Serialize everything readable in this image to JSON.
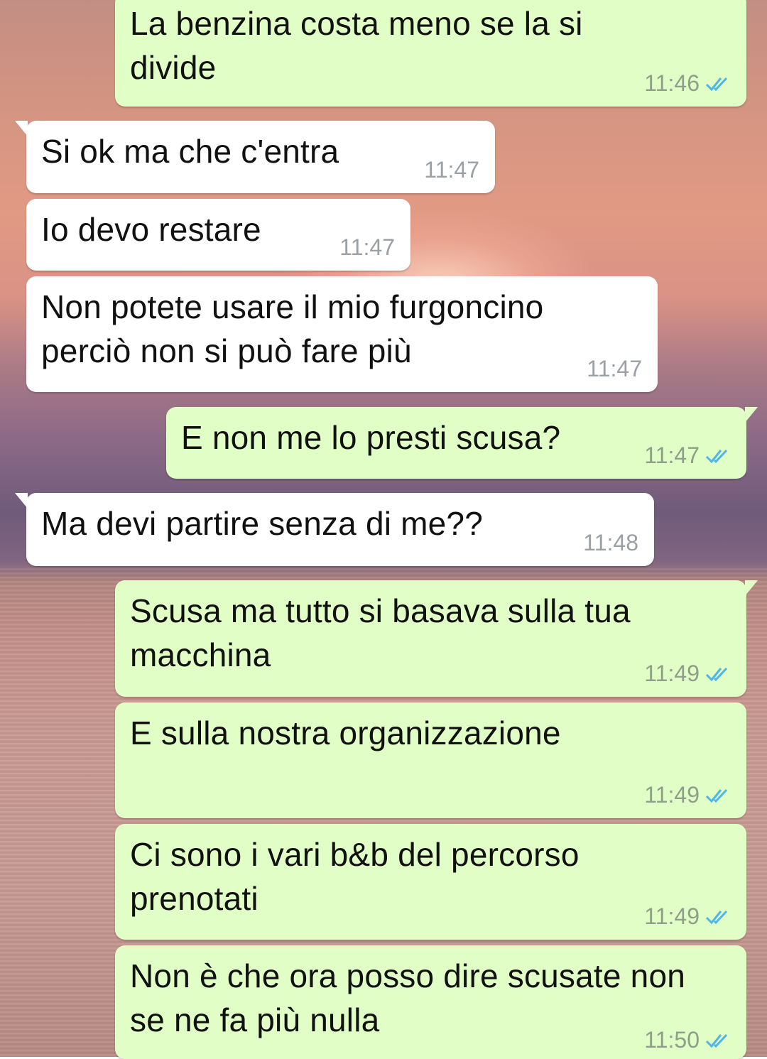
{
  "messages": [
    {
      "direction": "outgoing",
      "text": "La benzina costa meno se la si divide",
      "time": "11:46",
      "read": true
    },
    {
      "direction": "incoming",
      "text": "Si ok ma che c'entra",
      "time": "11:47"
    },
    {
      "direction": "incoming",
      "text": "Io devo restare",
      "time": "11:47"
    },
    {
      "direction": "incoming",
      "text": "Non potete usare il mio furgoncino perciò non si può fare più",
      "time": "11:47"
    },
    {
      "direction": "outgoing",
      "text": "E non me lo presti scusa?",
      "time": "11:47",
      "read": true
    },
    {
      "direction": "incoming",
      "text": "Ma devi partire senza di me??",
      "time": "11:48"
    },
    {
      "direction": "outgoing",
      "text": "Scusa ma tutto si basava sulla tua macchina",
      "time": "11:49",
      "read": true
    },
    {
      "direction": "outgoing",
      "text": "E sulla nostra organizzazione",
      "time": "11:49",
      "read": true
    },
    {
      "direction": "outgoing",
      "text": "Ci sono i vari b&b del percorso prenotati",
      "time": "11:49",
      "read": true
    },
    {
      "direction": "outgoing",
      "text": "Non è che ora posso dire scusate non se ne fa più nulla",
      "time": "11:50",
      "read": true
    }
  ],
  "colors": {
    "outgoing_bubble": "#e1fec6",
    "incoming_bubble": "#ffffff",
    "read_tick": "#4fb6ec"
  },
  "icons": {
    "read_receipt": "double-check-icon"
  }
}
